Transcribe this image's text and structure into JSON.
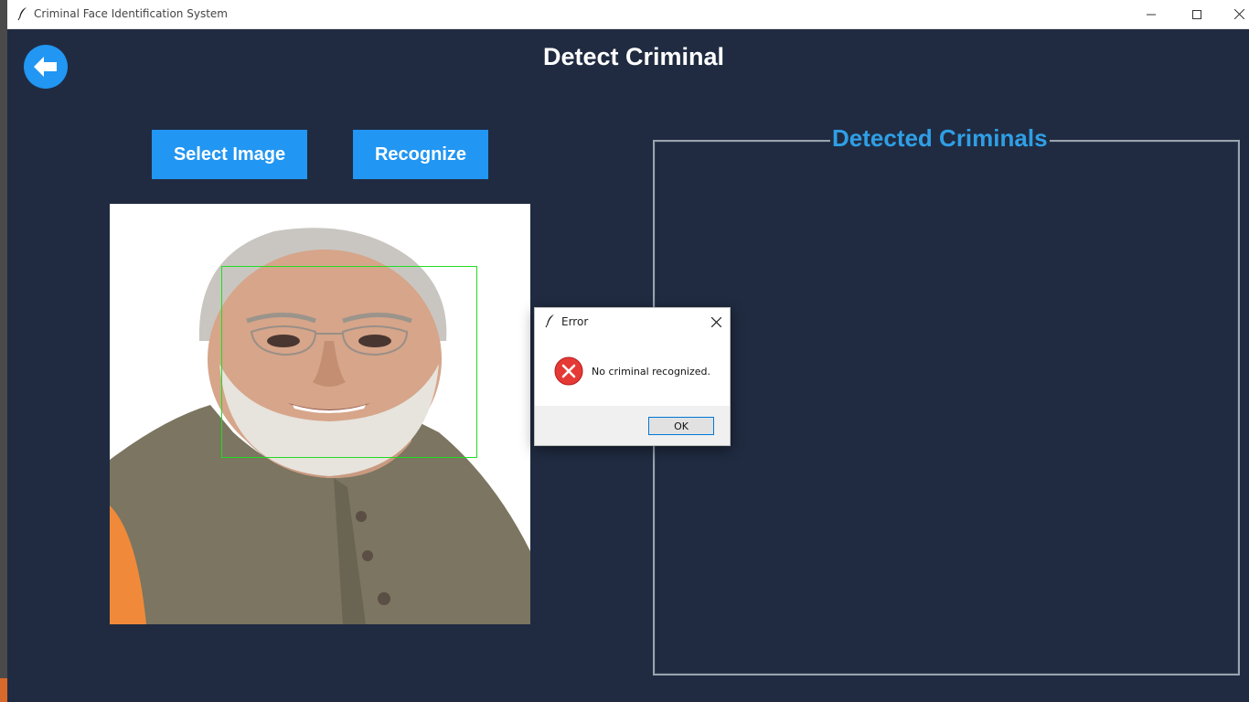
{
  "window": {
    "title": "Criminal Face Identification System"
  },
  "page": {
    "title": "Detect Criminal"
  },
  "toolbar": {
    "select_label": "Select Image",
    "recognize_label": "Recognize"
  },
  "results": {
    "title": "Detected Criminals"
  },
  "dialog": {
    "title": "Error",
    "message": "No criminal recognized.",
    "ok_label": "OK"
  },
  "colors": {
    "background": "#202b41",
    "accent": "#2196f3",
    "panel_title": "#2f9fe6",
    "face_box": "#22dd22",
    "error": "#e53935"
  },
  "icons": [
    "feather-icon",
    "minimize-icon",
    "maximize-icon",
    "close-icon",
    "back-arrow-icon",
    "error-icon"
  ]
}
